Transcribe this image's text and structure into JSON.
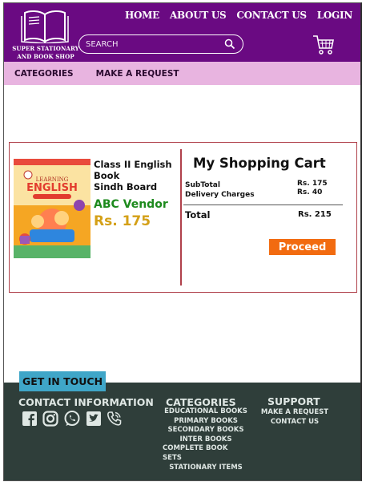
{
  "brand": {
    "name_line1": "SUPER STATIONARY",
    "name_line2": "AND BOOK SHOP"
  },
  "nav": {
    "items": [
      "HOME",
      "ABOUT US",
      "CONTACT US",
      "LOGIN"
    ]
  },
  "search": {
    "placeholder": "SEARCH"
  },
  "subnav": {
    "categories": "CATEGORIES",
    "request": "MAKE A REQUEST"
  },
  "product": {
    "title": "Class II English Book",
    "board": "Sindh Board",
    "vendor": "ABC Vendor",
    "price": "Rs. 175",
    "cover_title": "LEARNING ENGLISH"
  },
  "cart": {
    "title": "My Shopping Cart",
    "subtotal_label": "SubTotal",
    "subtotal_value": "Rs. 175",
    "delivery_label": "Delivery Charges",
    "delivery_value": "Rs. 40",
    "total_label": "Total",
    "total_value": "Rs. 215",
    "proceed_label": "Proceed"
  },
  "footer": {
    "get_in_touch": "GET IN TOUCH",
    "contact_heading": "CONTACT INFORMATION",
    "social_icons": [
      "facebook-icon",
      "instagram-icon",
      "whatsapp-icon",
      "twitter-icon",
      "phone-icon"
    ],
    "categories_heading": "CATEGORIES",
    "categories": [
      "EDUCATIONAL BOOKS",
      "PRIMARY BOOKS",
      "SECONDARY BOOKS",
      "INTER BOOKS",
      "COMPLETE BOOK SETS",
      "STATIONARY ITEMS"
    ],
    "support_heading": "SUPPORT",
    "support": [
      "MAKE A REQUEST",
      "CONTACT US"
    ]
  },
  "colors": {
    "header_bg": "#6a0a82",
    "subnav_bg": "#e8b4e0",
    "panel_border": "#b0414b",
    "vendor_green": "#1d8a1d",
    "price_gold": "#d4a017",
    "proceed_orange": "#f26b10",
    "footer_bg": "#2f3e3a",
    "touch_blue": "#3fa6c8"
  }
}
